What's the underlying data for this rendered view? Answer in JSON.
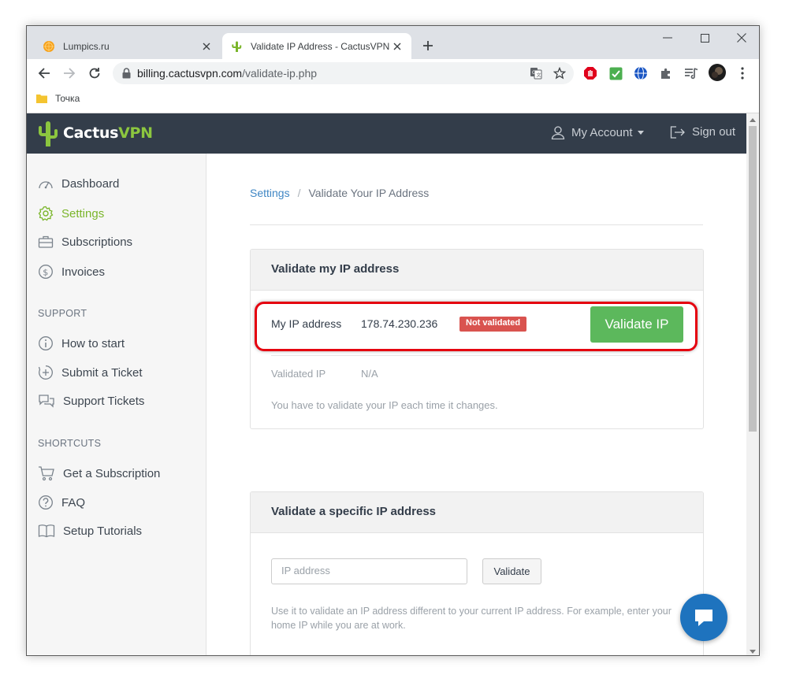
{
  "browser": {
    "tabs": [
      {
        "title": "Lumpics.ru",
        "favicon": "orange-icon",
        "active": false
      },
      {
        "title": "Validate IP Address - CactusVPN",
        "favicon": "cactus-icon",
        "active": true
      }
    ],
    "address": {
      "domain": "billing.cactusvpn.com",
      "path": "/validate-ip.php"
    },
    "bookmarks": [
      {
        "label": "Точка",
        "icon": "folder-icon"
      }
    ],
    "extensions": [
      "adblock-icon",
      "check-icon",
      "globe-icon",
      "puzzle-icon",
      "playlist-icon",
      "profile-avatar"
    ]
  },
  "site": {
    "brand": {
      "part1": "Cactus",
      "part2": "VPN",
      "accent": "#8cc63f"
    },
    "header": {
      "account": "My Account",
      "signout": "Sign out"
    },
    "sidebar": {
      "items": [
        {
          "label": "Dashboard",
          "icon": "speedometer-icon",
          "active": false
        },
        {
          "label": "Settings",
          "icon": "gear-icon",
          "active": true
        },
        {
          "label": "Subscriptions",
          "icon": "briefcase-icon",
          "active": false
        },
        {
          "label": "Invoices",
          "icon": "dollar-icon",
          "active": false
        }
      ],
      "support_heading": "SUPPORT",
      "support_items": [
        {
          "label": "How to start",
          "icon": "info-icon"
        },
        {
          "label": "Submit a Ticket",
          "icon": "plus-circle-icon"
        },
        {
          "label": "Support Tickets",
          "icon": "chat-bubbles-icon"
        }
      ],
      "shortcuts_heading": "SHORTCUTS",
      "shortcut_items": [
        {
          "label": "Get a Subscription",
          "icon": "cart-icon"
        },
        {
          "label": "FAQ",
          "icon": "question-icon"
        },
        {
          "label": "Setup Tutorials",
          "icon": "book-icon"
        }
      ]
    },
    "breadcrumb": {
      "parent": "Settings",
      "separator": "/",
      "current": "Validate Your IP Address"
    },
    "validate_panel": {
      "title": "Validate my IP address",
      "ip_label": "My IP address",
      "ip_value": "178.74.230.236",
      "status_badge": "Not validated",
      "status_color": "#d9534f",
      "button": "Validate IP",
      "button_color": "#5cb85c",
      "validated_label": "Validated IP",
      "validated_value": "N/A",
      "note": "You have to validate your IP each time it changes."
    },
    "specific_panel": {
      "title": "Validate a specific IP address",
      "input_placeholder": "IP address",
      "button": "Validate",
      "help": "Use it to validate an IP address different to your current IP address. For example, enter your home IP while you are at work."
    }
  }
}
